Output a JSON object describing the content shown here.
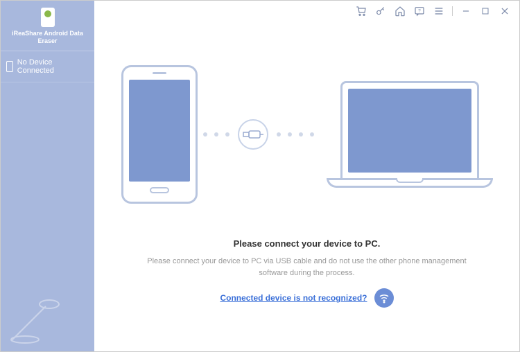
{
  "app": {
    "name": "iReaShare Android Data Eraser"
  },
  "sidebar": {
    "device_status": "No Device Connected"
  },
  "titlebar": {
    "cart": "cart-icon",
    "key": "key-icon",
    "home": "home-icon",
    "feedback": "feedback-icon",
    "menu": "menu-icon",
    "minimize": "minimize-icon",
    "maximize": "maximize-icon",
    "close": "close-icon"
  },
  "main": {
    "prompt_title": "Please connect your device to PC.",
    "prompt_desc": "Please connect your device to PC via USB cable and do not use the other phone management software during the process.",
    "help_link": "Connected device is not recognized?"
  }
}
